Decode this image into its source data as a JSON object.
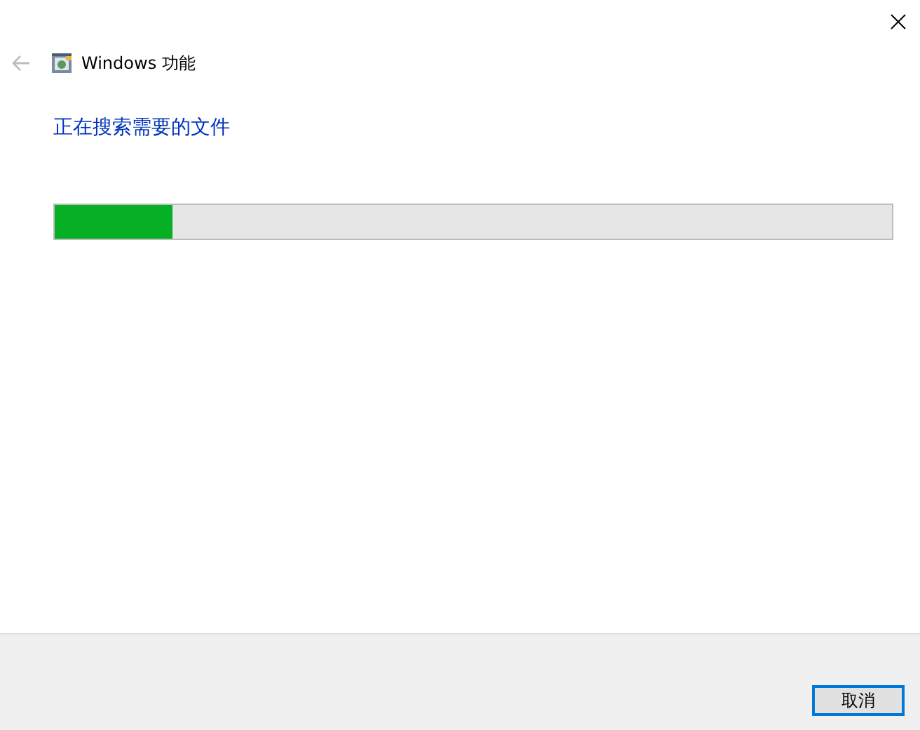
{
  "window": {
    "title": "Windows 功能",
    "back_disabled": true
  },
  "heading": "正在搜索需要的文件",
  "progress": {
    "level": 0.14
  },
  "buttons": [
    {
      "label": "取消",
      "focused": true
    }
  ]
}
